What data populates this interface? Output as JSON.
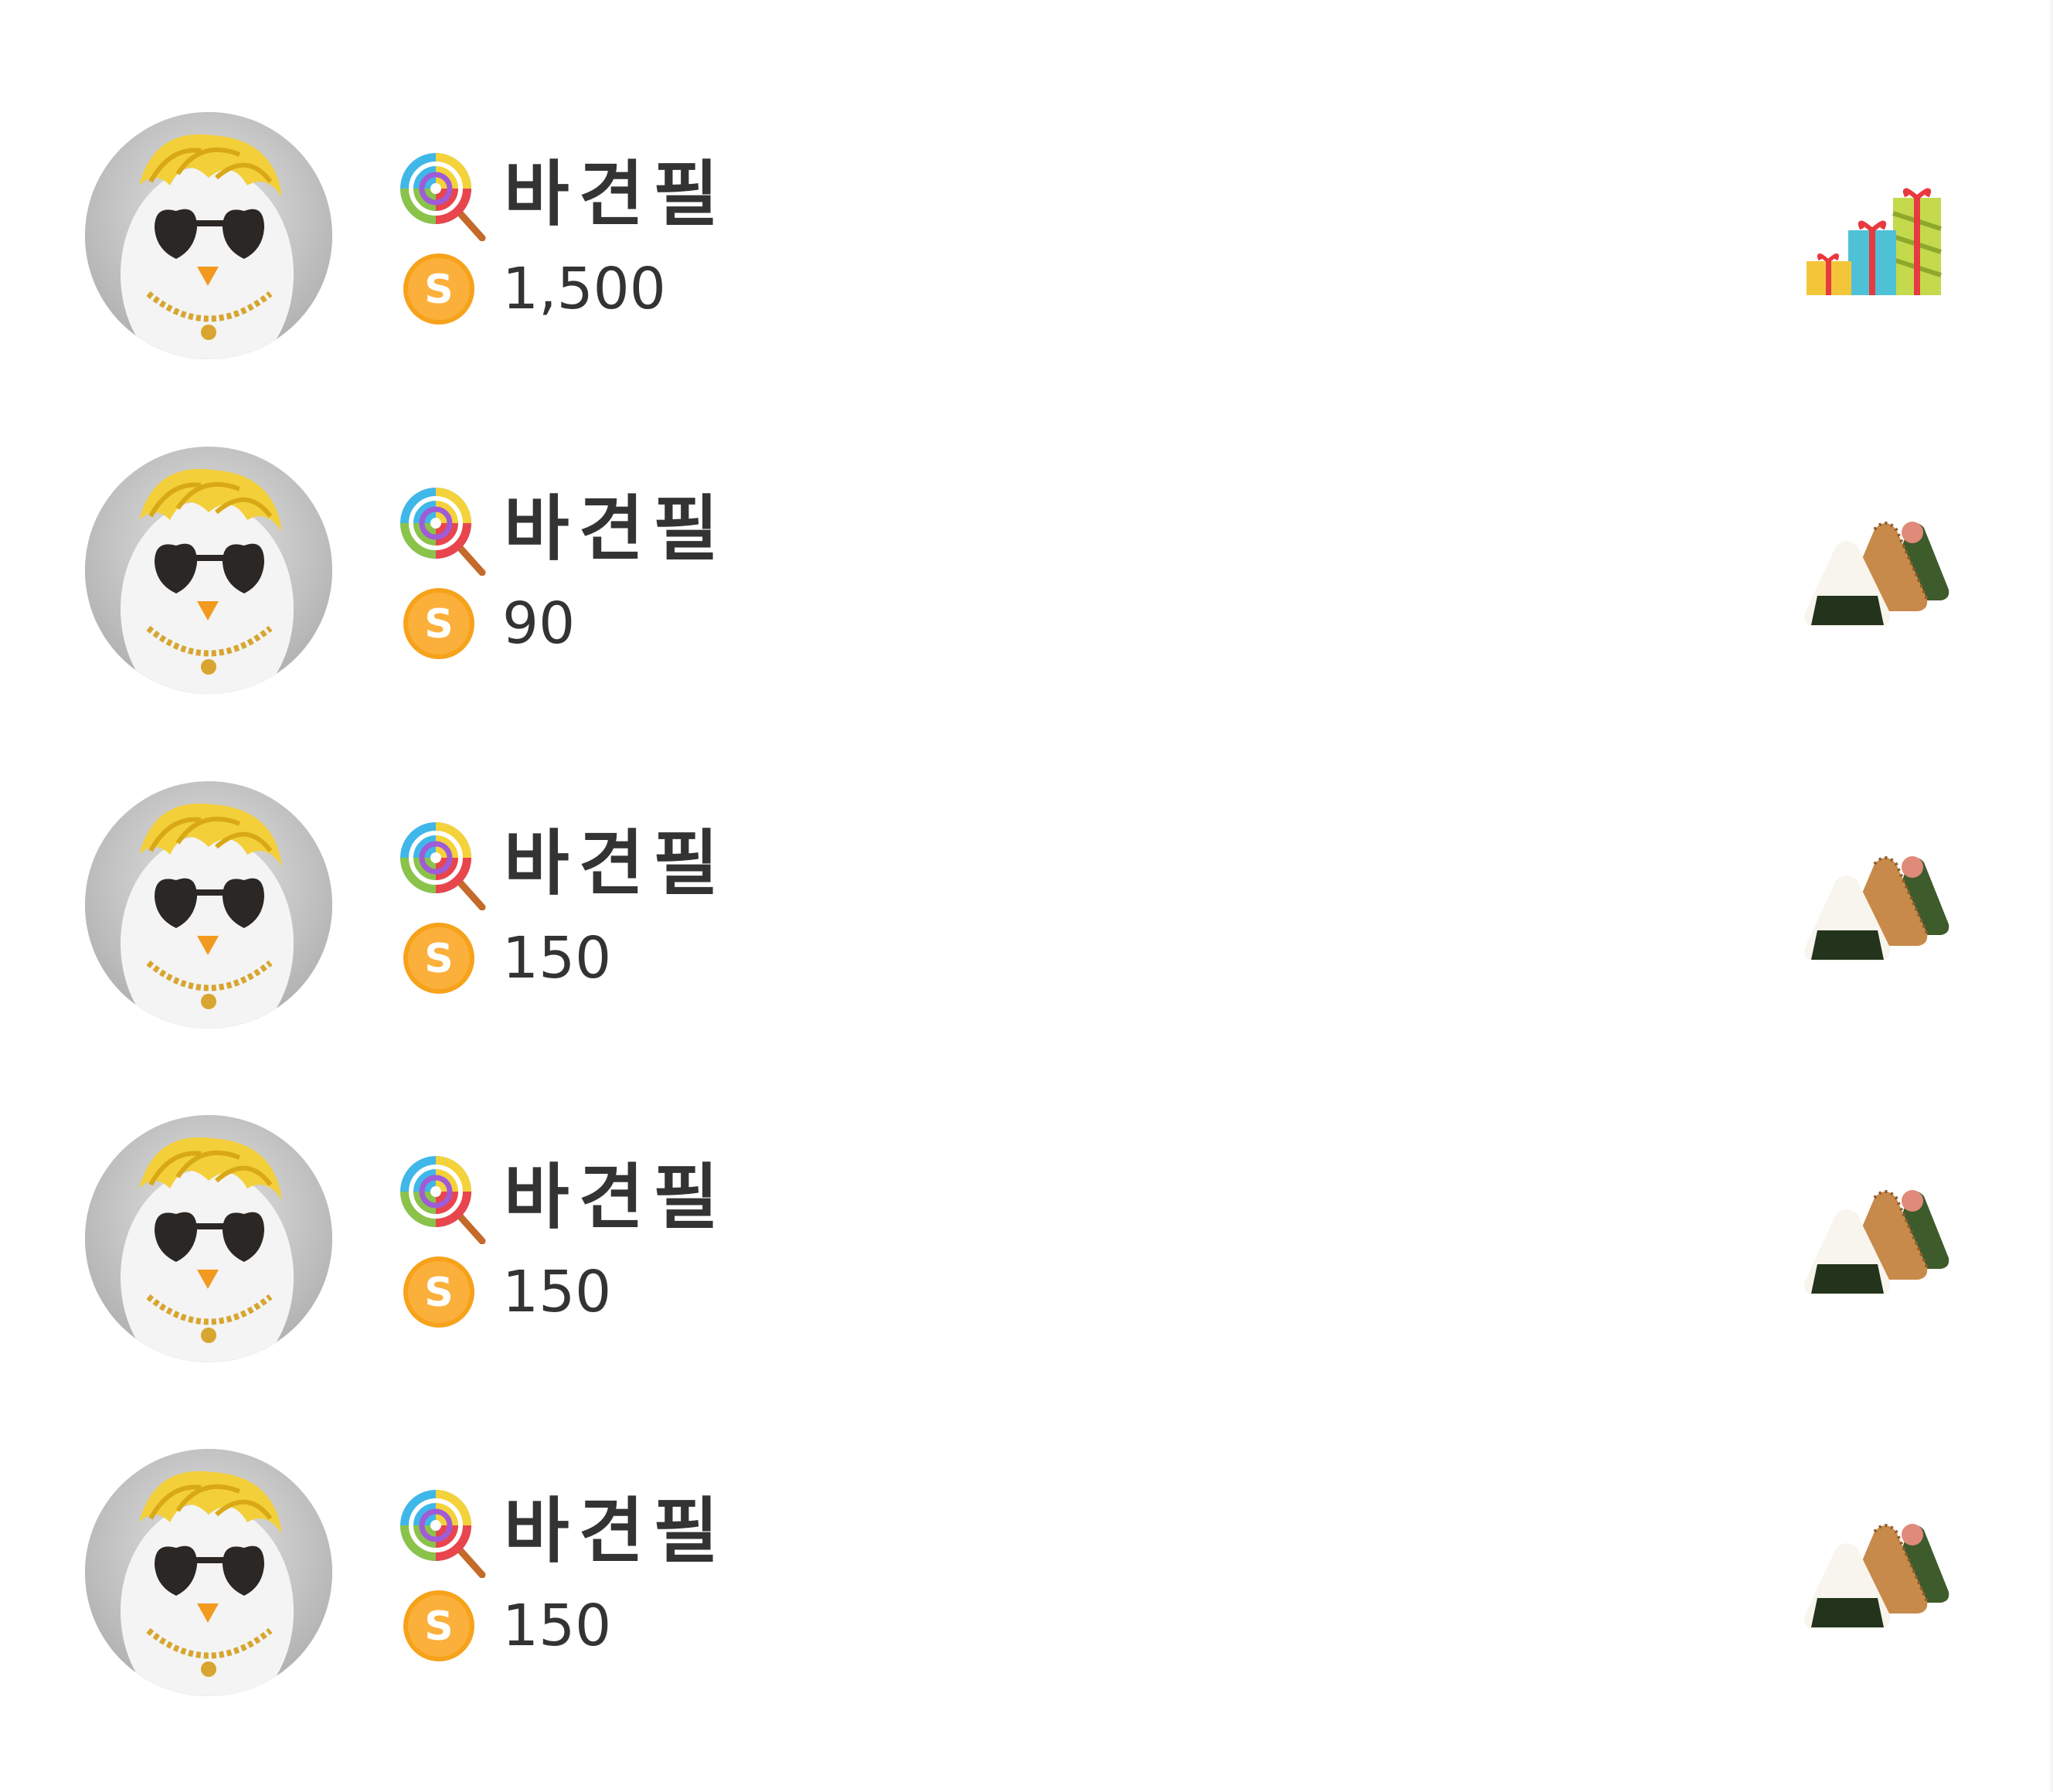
{
  "colors": {
    "text": "#333333",
    "coin_gold": "#f7a21b",
    "background": "#ffffff"
  },
  "items": [
    {
      "name": "바견필",
      "badge_icon": "lollipop-icon",
      "currency_icon": "coin-s-icon",
      "amount": "1,500",
      "item_icon": "gift-boxes-icon"
    },
    {
      "name": "바견필",
      "badge_icon": "lollipop-icon",
      "currency_icon": "coin-s-icon",
      "amount": "90",
      "item_icon": "onigiri-icon"
    },
    {
      "name": "바견필",
      "badge_icon": "lollipop-icon",
      "currency_icon": "coin-s-icon",
      "amount": "150",
      "item_icon": "onigiri-icon"
    },
    {
      "name": "바견필",
      "badge_icon": "lollipop-icon",
      "currency_icon": "coin-s-icon",
      "amount": "150",
      "item_icon": "onigiri-icon"
    },
    {
      "name": "바견필",
      "badge_icon": "lollipop-icon",
      "currency_icon": "coin-s-icon",
      "amount": "150",
      "item_icon": "onigiri-icon"
    }
  ],
  "coin_letter": "S"
}
